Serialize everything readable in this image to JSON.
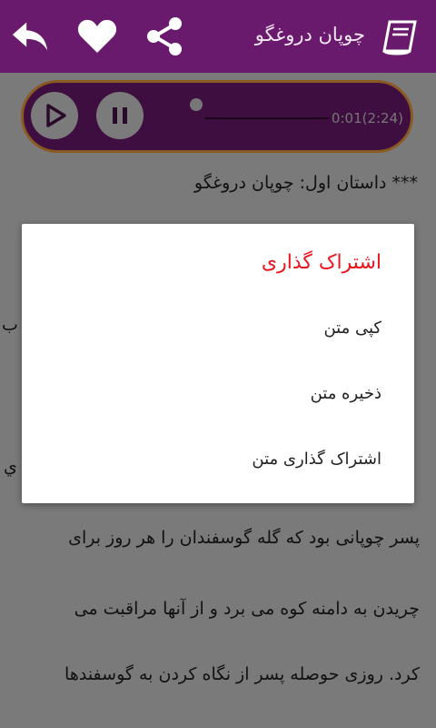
{
  "appbar": {
    "title": "چوپان دروغگو",
    "icons": [
      "back-icon",
      "heart-icon",
      "share-icon",
      "book-icon"
    ]
  },
  "player": {
    "time": "0:01(2:24)",
    "progress": 0.0069
  },
  "story": {
    "heading": "*** داستان اول: چوپان دروغگو",
    "lines": [
      "پسر چوپانی بود که گله گوسفندان را هر روز برای",
      "چریدن به دامنه کوه می برد و از آنها مراقبت می",
      "کرد. روزی حوصله پسر از نگاه کردن به گوسفندها"
    ],
    "partial_chars": [
      "ب",
      "ي"
    ]
  },
  "dialog": {
    "title": "اشتراک گذاری",
    "items": [
      "کپی متن",
      "ذخیره متن",
      "اشتراک گذاری متن"
    ]
  },
  "colors": {
    "appbar": "#6a1a6c",
    "player_bg": "#3f0e40",
    "dialog_title": "#e8141e"
  }
}
